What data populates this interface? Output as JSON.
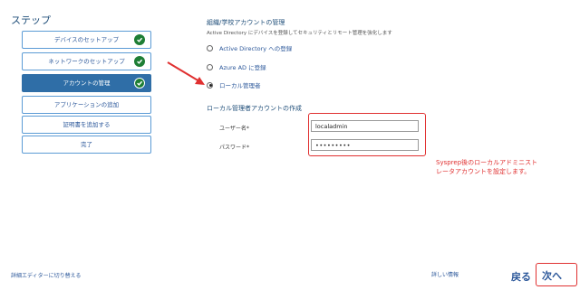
{
  "steps_title": "ステップ",
  "steps": [
    {
      "label": "デバイスのセットアップ",
      "done": true,
      "active": false
    },
    {
      "label": "ネットワークのセットアップ",
      "done": true,
      "active": false
    },
    {
      "label": "アカウントの管理",
      "done": true,
      "active": true
    },
    {
      "label": "アプリケーションの追加",
      "done": false,
      "active": false
    },
    {
      "label": "証明書を追加する",
      "done": false,
      "active": false
    },
    {
      "label": "完了",
      "done": false,
      "active": false
    }
  ],
  "management": {
    "title": "組織/学校アカウントの管理",
    "subtitle": "Active Directory にデバイスを登録してセキュリティとリモート管理を強化します",
    "options": [
      {
        "label": "Active Directory への登録",
        "selected": false
      },
      {
        "label": "Azure AD に登録",
        "selected": false
      },
      {
        "label": "ローカル管理者",
        "selected": true
      }
    ]
  },
  "local_admin": {
    "title": "ローカル管理者アカウントの作成",
    "username_label": "ユーザー名*",
    "username_value": "localadmin",
    "password_label": "パスワード*",
    "password_value": "•••••••••"
  },
  "callout": {
    "line1": "Sysprep後のローカルアドミニスト",
    "line2": "レータアカウントを設定します。"
  },
  "footer": {
    "advanced_editor": "詳細エディターに切り替える",
    "details": "詳しい情報",
    "back": "戻る",
    "next": "次へ"
  },
  "colors": {
    "accent": "#2f6ea7",
    "annotation_red": "#e03030",
    "check_green": "#1e7e34"
  }
}
